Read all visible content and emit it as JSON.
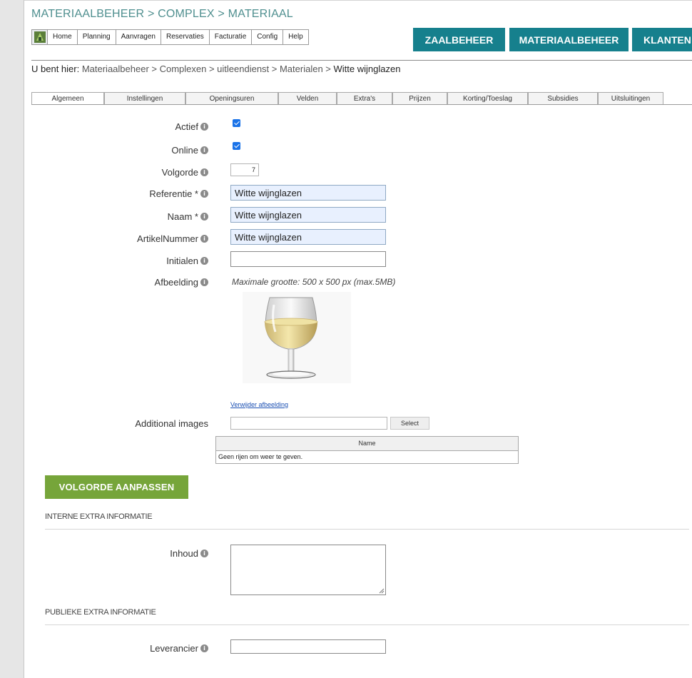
{
  "header": {
    "app_title": "MATERIAALBEHEER > COMPLEX > MATERIAAL"
  },
  "menu": {
    "logo_icon": "app-logo-icon",
    "items": [
      "Home",
      "Planning",
      "Aanvragen",
      "Reservaties",
      "Facturatie",
      "Config",
      "Help"
    ]
  },
  "top_buttons": [
    "ZAALBEHEER",
    "MATERIAALBEHEER",
    "KLANTEN"
  ],
  "colors": {
    "teal_accent": "#16808d",
    "green_button": "#76a53a",
    "title_teal": "#4f8f8f",
    "checkbox_blue": "#1a73e8",
    "autofill_blue": "#e8f0fe"
  },
  "breadcrumb": {
    "prefix": "U bent hier:",
    "path": "Materiaalbeheer > Complexen > uitleendienst > Materialen >",
    "current": "Witte wijnglazen"
  },
  "tabs": [
    "Algemeen",
    "Instellingen",
    "Openingsuren",
    "Velden",
    "Extra's",
    "Prijzen",
    "Korting/Toeslag",
    "Subsidies",
    "Uitsluitingen"
  ],
  "form": {
    "actief": {
      "label": "Actief",
      "checked": true
    },
    "online": {
      "label": "Online",
      "checked": true
    },
    "volgorde": {
      "label": "Volgorde",
      "value": "7"
    },
    "referentie": {
      "label": "Referentie *",
      "value": "Witte wijnglazen"
    },
    "naam": {
      "label": "Naam *",
      "value": "Witte wijnglazen"
    },
    "artikelnummer": {
      "label": "ArtikelNummer",
      "value": "Witte wijnglazen"
    },
    "initialen": {
      "label": "Initialen",
      "value": ""
    },
    "afbeelding": {
      "label": "Afbeelding",
      "hint": "Maximale grootte: 500 x 500 px (max.5MB)",
      "image": "white-wine-glass-image",
      "remove_link": "Verwijder afbeelding"
    },
    "additional_images": {
      "label": "Additional images",
      "select_label": "Select",
      "grid_header": "Name",
      "empty_text": "Geen rijen om weer te geven."
    }
  },
  "reorder_button": "VOLGORDE AANPASSEN",
  "sections": {
    "interne": {
      "title": "INTERNE EXTRA INFORMATIE",
      "inhoud_label": "Inhoud"
    },
    "publieke": {
      "title": "PUBLIEKE EXTRA INFORMATIE",
      "leverancier_label": "Leverancier"
    }
  },
  "info_icon": "info-icon"
}
